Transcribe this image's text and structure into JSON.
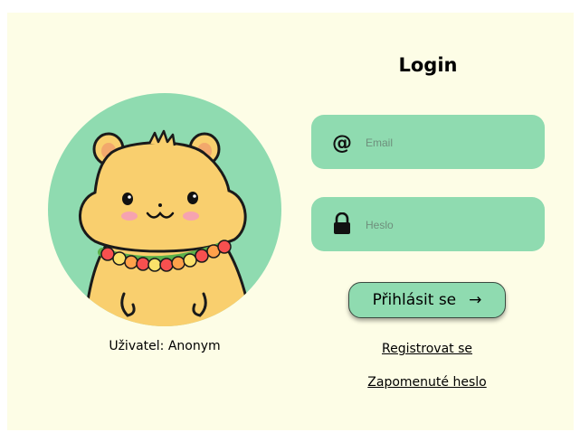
{
  "profile": {
    "user_label": "Uživatel: Anonym"
  },
  "login": {
    "title": "Login",
    "email_placeholder": "Email",
    "password_placeholder": "Heslo",
    "submit_label": "Přihlásit se",
    "submit_arrow": "→",
    "register_link": "Registrovat se",
    "forgot_link": "Zapomenuté heslo"
  },
  "icons": {
    "email": "at-sign-icon",
    "password": "lock-icon",
    "submit": "arrow-right-icon"
  },
  "colors": {
    "background": "#fdfde6",
    "accent": "#8fdbb0",
    "hamster": "#f9cf6e"
  }
}
